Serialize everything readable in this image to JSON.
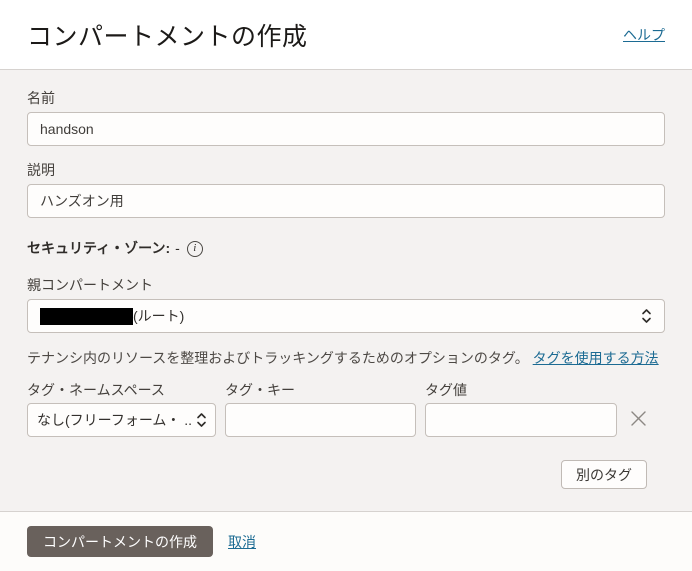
{
  "dialog": {
    "title": "コンパートメントの作成",
    "help_link": "ヘルプ"
  },
  "fields": {
    "name": {
      "label": "名前",
      "value": "handson"
    },
    "description": {
      "label": "説明",
      "value": "ハンズオン用"
    },
    "security_zone": {
      "label": "セキュリティ・ゾーン:",
      "value": "-",
      "info_icon_glyph": "i"
    },
    "parent_compartment": {
      "label": "親コンパートメント",
      "value_redacted": true,
      "value_suffix": "(ルート)"
    }
  },
  "tags": {
    "intro": "テナンシ内のリソースを整理およびトラッキングするためのオプションのタグ。",
    "help_link": "タグを使用する方法",
    "namespace": {
      "label": "タグ・ネームスペース",
      "selected_value": "なし(フリーフォーム・ ..."
    },
    "key": {
      "label": "タグ・キー",
      "value": ""
    },
    "value": {
      "label": "タグ値",
      "value": ""
    },
    "another_tag_button": "別のタグ"
  },
  "actions": {
    "create_button": "コンパートメントの作成",
    "cancel_link": "取消"
  },
  "colors": {
    "link": "#1c6b93",
    "primary_button_bg": "#69615c",
    "primary_button_text": "#ffffff",
    "body_bg": "#f4f2f1",
    "header_bg": "#ffffff",
    "footer_bg": "#fdfcfa",
    "input_border": "#c5bfba",
    "divider": "#d6d2cf",
    "redaction": "#000000"
  }
}
